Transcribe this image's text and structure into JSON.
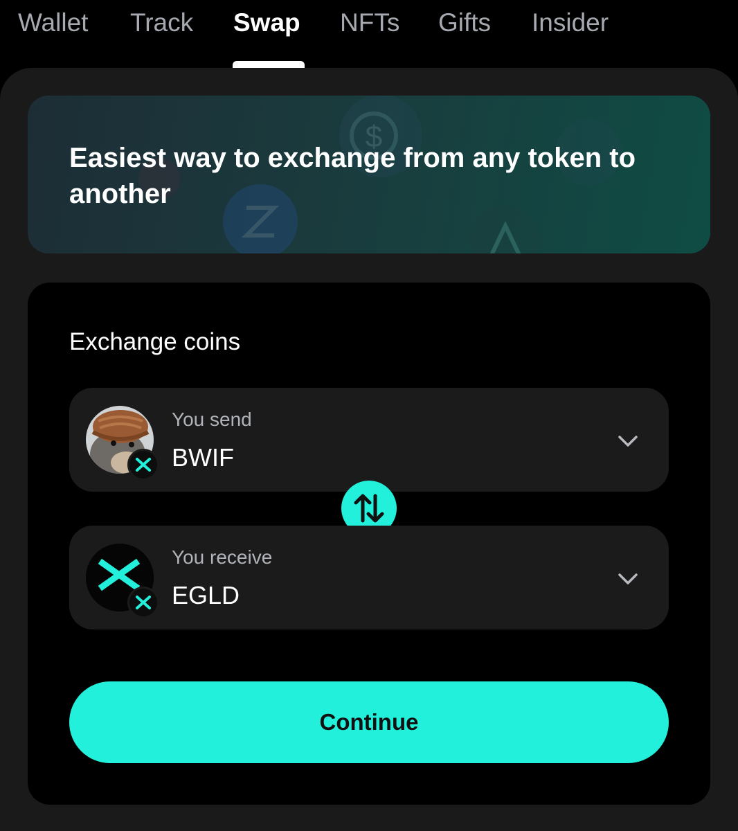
{
  "tabs": [
    {
      "label": "Wallet"
    },
    {
      "label": "Track"
    },
    {
      "label": "Swap"
    },
    {
      "label": "NFTs"
    },
    {
      "label": "Gifts"
    },
    {
      "label": "Insider"
    }
  ],
  "active_tab": "Swap",
  "banner": {
    "title": "Easiest way to exchange from any token to another"
  },
  "exchange": {
    "title": "Exchange coins",
    "send": {
      "label": "You send",
      "token": "BWIF",
      "icon": "bwif-token-icon"
    },
    "receive": {
      "label": "You receive",
      "token": "EGLD",
      "icon": "egld-token-icon"
    },
    "swap_icon": "swap-arrows-icon",
    "continue_label": "Continue"
  },
  "colors": {
    "accent": "#23f0da",
    "background": "#000000",
    "panel": "#1a1a1a",
    "field": "#1b1b1b",
    "muted_text": "#a6a9b0"
  }
}
